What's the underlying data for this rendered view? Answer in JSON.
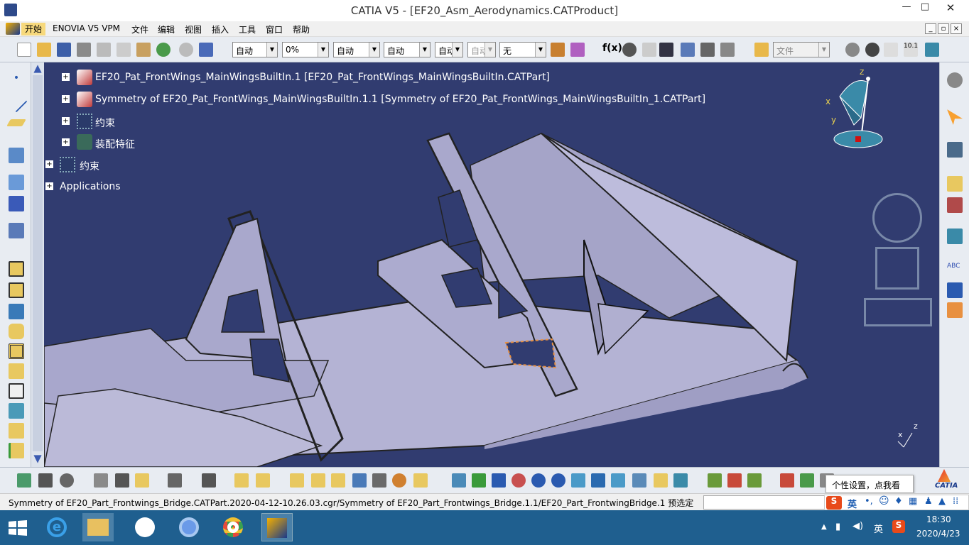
{
  "window": {
    "title": "CATIA V5 - [EF20_Asm_Aerodynamics.CATProduct]",
    "minimize": "—",
    "maximize": "□",
    "close": "✕"
  },
  "menu": {
    "items": [
      "开始",
      "ENOVIA V5 VPM",
      "文件",
      "编辑",
      "视图",
      "插入",
      "工具",
      "窗口",
      "帮助"
    ]
  },
  "toolbar": {
    "combo1": "自动",
    "combo2": "0%",
    "combo3": "自动",
    "combo4": "自动",
    "combo5": "自动",
    "combo6": "自动",
    "combo7": "无",
    "combo8": "文件"
  },
  "tree": {
    "items": [
      "EF20_Pat_FrontWings_MainWingsBuiltIn.1 [EF20_Pat_FrontWings_MainWingsBuiltIn.CATPart]",
      "Symmetry of EF20_Pat_FrontWings_MainWingsBuiltIn.1.1 [Symmetry of EF20_Pat_FrontWings_MainWingsBuiltIn_1.CATPart]",
      "约束",
      "装配特征",
      "约束",
      "Applications"
    ]
  },
  "compass": {
    "x": "x",
    "y": "y",
    "z": "z"
  },
  "axis_small": {
    "x": "x",
    "z": "z"
  },
  "status": {
    "message": "Symmetry of EF20_Part_Frontwings_Bridge.CATPart.2020-04-12-10.26.03.cgr/Symmetry of EF20_Part_Frontwings_Bridge.1.1/EF20_Part_FrontwingBridge.1 预选定"
  },
  "tooltip": {
    "text": "个性设置，点我看看"
  },
  "ime": {
    "lang": "英"
  },
  "tray": {
    "time": "18:30",
    "date": "2020/4/23",
    "lang": "英"
  },
  "brand": {
    "catia": "CATIA"
  },
  "colors": {
    "viewport": "#313c70",
    "part": "#b8b8d8",
    "accent": "#1f5f8f"
  }
}
